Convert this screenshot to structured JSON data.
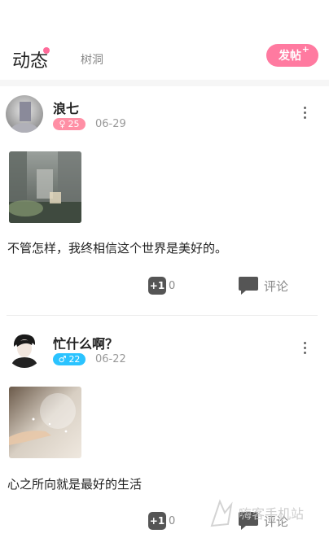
{
  "header": {
    "tab_active": "动态",
    "tab_inactive": "树洞",
    "post_button": "发帖",
    "post_button_plus": "+"
  },
  "posts": [
    {
      "username": "浪七",
      "badge": {
        "symbol": "♀",
        "value": "25",
        "color": "#ff8fa5"
      },
      "date": "06-29",
      "content": "不管怎样，我终相信这个世界是美好的。",
      "like_icon": "+1",
      "like_count": "0",
      "comment_label": "评论"
    },
    {
      "username": "忙什么啊？",
      "badge": {
        "symbol": "♂",
        "value": "22",
        "color": "#2ac3ff"
      },
      "date": "06-22",
      "content": "心之所向就是最好的生活",
      "like_icon": "+1",
      "like_count": "0",
      "comment_label": "评论"
    }
  ],
  "watermark": "嗨客手机站",
  "colors": {
    "accent": "#ff7aa0",
    "female": "#ff8fa5",
    "male": "#2ac3ff"
  }
}
